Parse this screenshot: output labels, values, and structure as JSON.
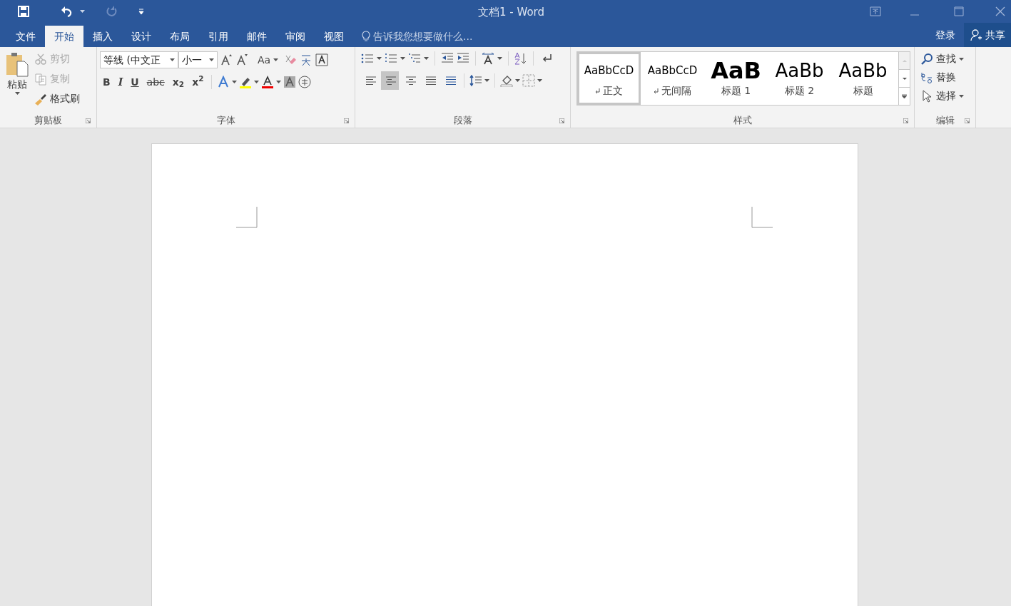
{
  "window": {
    "title": "文档1 - Word"
  },
  "tabs": [
    {
      "label": "文件",
      "selected": false
    },
    {
      "label": "开始",
      "selected": true
    },
    {
      "label": "插入",
      "selected": false
    },
    {
      "label": "设计",
      "selected": false
    },
    {
      "label": "布局",
      "selected": false
    },
    {
      "label": "引用",
      "selected": false
    },
    {
      "label": "邮件",
      "selected": false
    },
    {
      "label": "审阅",
      "selected": false
    },
    {
      "label": "视图",
      "selected": false
    }
  ],
  "tell_me": {
    "placeholder": "告诉我您想要做什么..."
  },
  "account": {
    "sign_in": "登录",
    "share": "共享"
  },
  "clipboard": {
    "label": "剪贴板",
    "paste": "粘贴",
    "items": [
      {
        "kind": "cut",
        "label": "剪切",
        "disabled": true
      },
      {
        "kind": "copy",
        "label": "复制",
        "disabled": true
      },
      {
        "kind": "painter",
        "label": "格式刷",
        "disabled": false
      }
    ]
  },
  "font": {
    "label": "字体",
    "name": "等线 (中文正",
    "size": "小一",
    "change_case": "Aa",
    "format_buttons": [
      {
        "kind": "bold",
        "text": "B"
      },
      {
        "kind": "italic",
        "text": "I"
      },
      {
        "kind": "underline",
        "text": "U"
      },
      {
        "kind": "strike",
        "text": "abc"
      },
      {
        "kind": "script",
        "text": "x$_{2}$"
      },
      {
        "kind": "script",
        "text": "x$^{2}$"
      }
    ]
  },
  "paragraph": {
    "label": "段落",
    "alignments": [
      {
        "kind": "left",
        "selected": false
      },
      {
        "kind": "center",
        "selected": true
      },
      {
        "kind": "right",
        "selected": false
      },
      {
        "kind": "justify",
        "selected": false
      },
      {
        "kind": "distributed",
        "selected": false
      }
    ]
  },
  "styles": {
    "label": "样式",
    "items": [
      {
        "kind": "normal",
        "sample": "AaBbCcD",
        "name": "正文",
        "selected": true
      },
      {
        "kind": "normal",
        "sample": "AaBbCcD",
        "name": "无间隔",
        "selected": false
      },
      {
        "kind": "heading1",
        "sample": "AaB",
        "name": "标题 1",
        "selected": false
      },
      {
        "kind": "heading2",
        "sample": "AaBb",
        "name": "标题 2",
        "selected": false
      },
      {
        "kind": "heading2",
        "sample": "AaBb",
        "name": "标题",
        "selected": false
      }
    ]
  },
  "editing": {
    "label": "编辑",
    "items": [
      {
        "kind": "find",
        "label": "查找"
      },
      {
        "kind": "replace",
        "label": "替换"
      },
      {
        "kind": "select",
        "label": "选择"
      }
    ]
  }
}
